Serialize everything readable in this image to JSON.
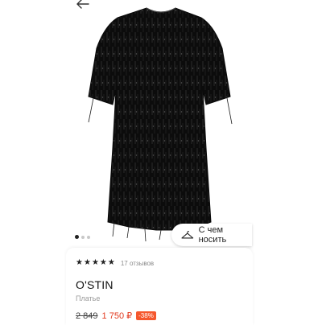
{
  "nav": {
    "back_icon": "arrow-left-icon"
  },
  "gallery": {
    "slide_count": 3,
    "active_slide": 1
  },
  "outfit_button": {
    "label": "С чем носить",
    "icon": "hanger-icon"
  },
  "product": {
    "rating": 5,
    "reviews_label": "17 отзывов",
    "brand": "O'STIN",
    "category": "Платье",
    "old_price": "2 849",
    "new_price": "1 750 ₽",
    "discount": "-38%"
  },
  "colors": {
    "sale": "#e23a1f",
    "discount_badge": "#f5572d",
    "text": "#111111"
  }
}
